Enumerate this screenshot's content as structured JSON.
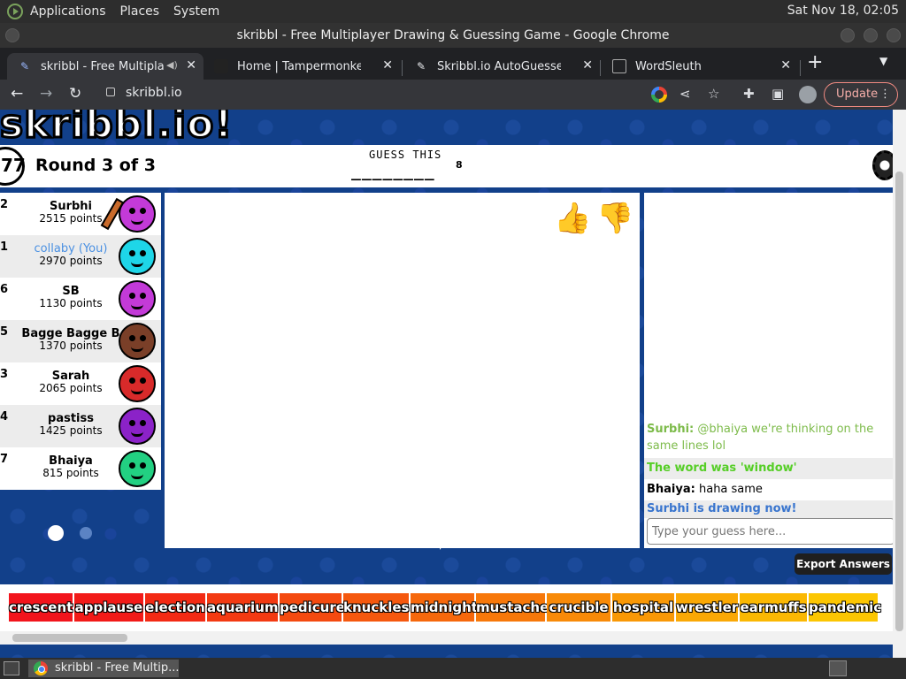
{
  "os_bar": {
    "menus": [
      "Applications",
      "Places",
      "System"
    ],
    "clock": "Sat Nov 18, 02:05"
  },
  "window_title": "skribbl - Free Multiplayer Drawing & Guessing Game - Google Chrome",
  "tabs": [
    {
      "title": "skribbl - Free Multiplayer",
      "icon": "skribbl-pencil-icon",
      "active": true
    },
    {
      "title": "Home | Tampermonkey",
      "icon": "tampermonkey-icon",
      "active": false
    },
    {
      "title": "Skribbl.io AutoGuesser",
      "icon": "script-icon",
      "active": false
    },
    {
      "title": "WordSleuth",
      "icon": "wordsleuth-icon",
      "active": false
    }
  ],
  "toolbar": {
    "url": "skribbl.io",
    "update_label": "Update"
  },
  "game": {
    "logo": "skribbl.io!",
    "timer": "77",
    "round_text": "Round 3 of 3",
    "guess_label": "GUESS THIS",
    "word_blanks": "________",
    "word_length": "8",
    "players": [
      {
        "rank": "2",
        "name": "Surbhi",
        "score": "2515 points",
        "color": "#c33ad8",
        "drawing": true
      },
      {
        "rank": "1",
        "name": "collaby (You)",
        "score": "2970 points",
        "color": "#1ed6e8",
        "you": true
      },
      {
        "rank": "6",
        "name": "SB",
        "score": "1130 points",
        "color": "#c33ad8"
      },
      {
        "rank": "5",
        "name": "Bagge Bagge B",
        "score": "1370 points",
        "color": "#7a3f28"
      },
      {
        "rank": "3",
        "name": "Sarah",
        "score": "2065 points",
        "color": "#d82a2a"
      },
      {
        "rank": "4",
        "name": "pastiss",
        "score": "1425 points",
        "color": "#8b22c8"
      },
      {
        "rank": "7",
        "name": "Bhaiya",
        "score": "815 points",
        "color": "#22d082"
      }
    ],
    "chat": [
      {
        "author": "Surbhi:",
        "text": "@bhaiya we're thinking on the same lines lol",
        "color": "#7dbb4a",
        "alt": false
      },
      {
        "author": "",
        "text": "The word was 'window'",
        "color": "#56ce27",
        "alt": true,
        "bold": true
      },
      {
        "author": "Bhaiya:",
        "text": "haha same",
        "color": "#000000",
        "alt": false
      },
      {
        "author": "",
        "text": "Surbhi is drawing now!",
        "color": "#3975ce",
        "alt": true,
        "bold": true
      }
    ],
    "chat_placeholder": "Type your guess here...",
    "export_label": "Export Answers",
    "word_chips": [
      {
        "word": "crescent",
        "color": "#f2141c"
      },
      {
        "word": "applause",
        "color": "#f21a18"
      },
      {
        "word": "election",
        "color": "#f32a14"
      },
      {
        "word": "aquarium",
        "color": "#f33a12"
      },
      {
        "word": "pedicure",
        "color": "#f44a10"
      },
      {
        "word": "knuckles",
        "color": "#f5580e"
      },
      {
        "word": "midnight",
        "color": "#f6680c"
      },
      {
        "word": "mustache",
        "color": "#f7780a"
      },
      {
        "word": "crucible",
        "color": "#f88a08"
      },
      {
        "word": "hospital",
        "color": "#f99806"
      },
      {
        "word": "wrestler",
        "color": "#faa805"
      },
      {
        "word": "earmuffs",
        "color": "#fbb803"
      },
      {
        "word": "pandemic",
        "color": "#fcc602"
      }
    ]
  },
  "taskbar": {
    "task_title": "skribbl - Free Multip..."
  }
}
